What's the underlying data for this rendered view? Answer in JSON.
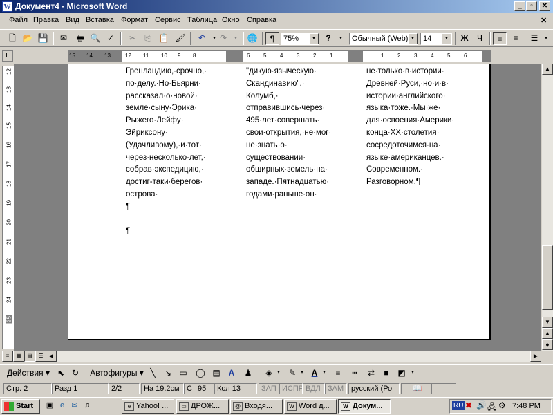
{
  "window": {
    "title": "Документ4 - Microsoft Word",
    "title_icon": "W",
    "controls": [
      "_",
      "▫",
      "✕"
    ]
  },
  "menu": {
    "items": [
      "Файл",
      "Правка",
      "Вид",
      "Вставка",
      "Формат",
      "Сервис",
      "Таблица",
      "Окно",
      "Справка"
    ],
    "close_glyph": "✕"
  },
  "toolbar": {
    "zoom": "75%",
    "style": "Обычный (Web)",
    "font_size": "14",
    "bold_label": "Ж",
    "underline_label": "Ч",
    "pilcrow": "¶"
  },
  "ruler": {
    "corner": "L",
    "h_numbers_left": [
      "15",
      "14",
      "13",
      "12",
      "11",
      "10",
      "9",
      "8"
    ],
    "h_numbers_mid": [
      "6",
      "5",
      "4",
      "3",
      "2",
      "1"
    ],
    "h_numbers_right": [
      "1",
      "2",
      "3",
      "4",
      "5",
      "6"
    ],
    "v_numbers": [
      "12",
      "13",
      "14",
      "15",
      "16",
      "17",
      "18",
      "19",
      "20",
      "21",
      "22",
      "23",
      "24",
      "25"
    ]
  },
  "document": {
    "col1": [
      "Гренландию,·срочно,·",
      "по·делу.·Но·Бьярни·",
      "рассказал·о·новой·",
      "земле·сыну·Эрика·",
      "Рыжего·Лейфу·",
      "Эйриксону·",
      "(Удачливому),·и·тот·",
      "через·несколько·лет,·",
      "собрав·экспедицию,·",
      "достиг-таки·берегов·",
      "острова·",
      "¶",
      "",
      "¶"
    ],
    "col2": [
      "\"дикую·языческую·",
      "Скандинавию\".·",
      "Колумб,·",
      "отправившись·через·",
      "495·лет·совершать·",
      "свои·открытия,·не·мог·",
      "не·знать·о·",
      "существовании·",
      "обширных·земель·на·",
      "западе.·Пятнадцатью·",
      "годами·раньше·он·"
    ],
    "col3": [
      "не·только·в·истории·",
      "Древней·Руси,·но·и·в·",
      "истории·английского·",
      "языка·тоже.·Мы·же·",
      "для·освоения·Америки·",
      "конца·XX·столетия·",
      "сосредоточимся·на·",
      "языке·американцев.·",
      "Современном.·",
      "Разговорном.¶"
    ]
  },
  "drawing": {
    "actions": "Действия ▾",
    "autoshapes": "Автофигуры ▾"
  },
  "status": {
    "page": "Стр. 2",
    "section": "Разд 1",
    "pages": "2/2",
    "position": "На 19.2см",
    "line": "Ст 95",
    "column": "Кол 13",
    "rec": "ЗАП",
    "trk": "ИСПР",
    "ext": "ВДЛ",
    "ovr": "ЗАМ",
    "language": "русский (Ро"
  },
  "taskbar": {
    "start": "Start",
    "tasks": [
      "Yahoo! ...",
      "ДРОЖ...",
      "Входя...",
      "Word д...",
      "Докум..."
    ],
    "lang": "RU",
    "clock": "7:48 PM"
  }
}
